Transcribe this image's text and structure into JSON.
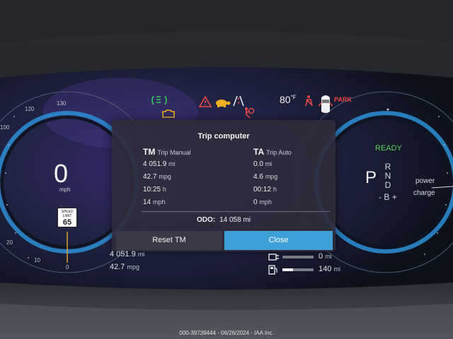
{
  "indicators": {
    "temperature": "80",
    "temperature_unit": "°F",
    "park_label": "PARK",
    "icons": [
      "headlight-icon",
      "check-engine-icon",
      "warning-triangle-icon",
      "turtle-icon",
      "lane-assist-icon",
      "airbag-icon",
      "seatbelt-icon",
      "car-door-icon"
    ],
    "colors": {
      "green": "#35c95b",
      "amber": "#f0b21e",
      "red": "#e94848"
    }
  },
  "left_gauge": {
    "speed": "0",
    "unit": "mph",
    "ticks": [
      "100",
      "120",
      "130",
      "20",
      "10",
      "0"
    ],
    "speed_limit_top": "SPEED LIMIT",
    "speed_limit_value": "65"
  },
  "right_gauge": {
    "ready": "READY",
    "gear": "P",
    "gears": [
      "R",
      "N",
      "D",
      "B"
    ],
    "gear_minus": "-",
    "gear_plus": "+",
    "power_label": "power",
    "charge_label": "charge"
  },
  "trip_computer": {
    "title": "Trip computer",
    "tm": {
      "code": "TM",
      "label": "Trip Manual",
      "distance": "4 051.9",
      "distance_unit": "mi",
      "economy": "42.7",
      "economy_unit": "mpg",
      "time": "10:25",
      "time_unit": "h",
      "speed": "14",
      "speed_unit": "mph"
    },
    "ta": {
      "code": "TA",
      "label": "Trip Auto",
      "distance": "0.0",
      "distance_unit": "mi",
      "economy": "4.6",
      "economy_unit": "mpg",
      "time": "00:12",
      "time_unit": "h",
      "speed": "0",
      "speed_unit": "mph"
    },
    "odo_label": "ODO:",
    "odo_value": "14 058",
    "odo_unit": "mi",
    "reset_button": "Reset TM",
    "close_button": "Close"
  },
  "bottom": {
    "trip_distance": "4 051.9",
    "trip_distance_unit": "mi",
    "trip_economy": "42.7",
    "trip_economy_unit": "mpg",
    "electric_range": "0",
    "electric_range_unit": "mi",
    "electric_level": 0.0,
    "fuel_range": "140",
    "fuel_range_unit": "mi",
    "fuel_level": 0.35
  },
  "watermark": "000-39739444 - 06/26/2024 - IAA Inc."
}
